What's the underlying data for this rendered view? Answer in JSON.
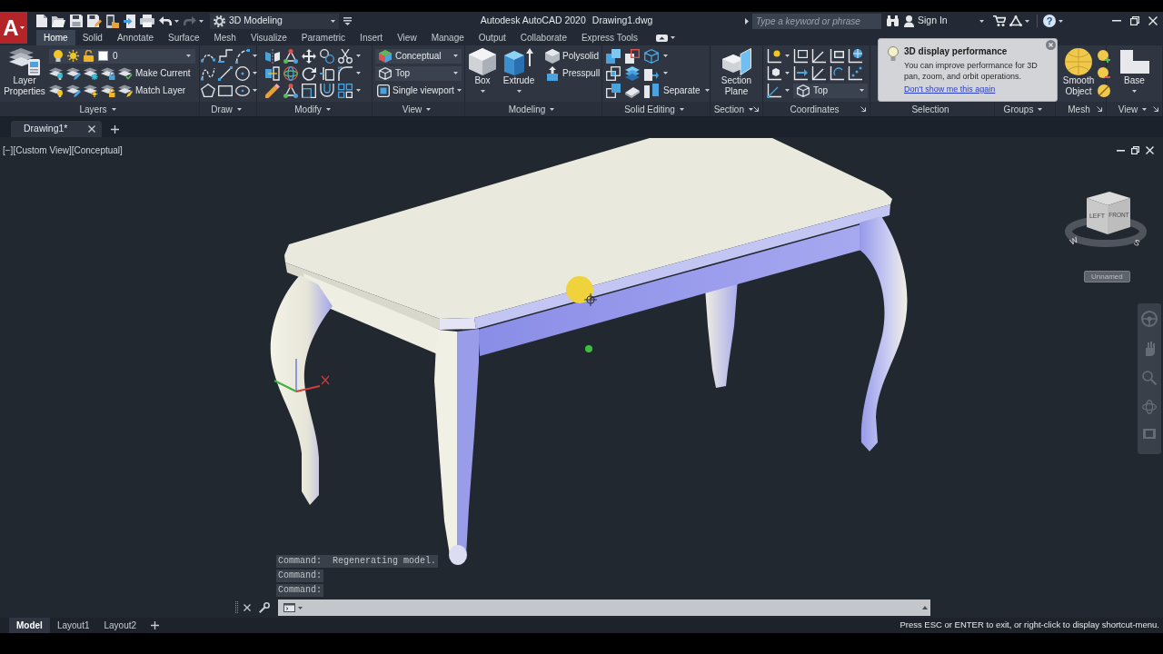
{
  "title_bar": {
    "app_button": "A",
    "workspace": "3D Modeling",
    "app_title": "Autodesk AutoCAD 2020",
    "document_title": "Drawing1.dwg",
    "search": {
      "placeholder": "Type a keyword or phrase"
    },
    "sign_in": "Sign In",
    "help": "?"
  },
  "ribbon_tabs": [
    {
      "label": "Home",
      "selected": true
    },
    {
      "label": "Solid",
      "selected": false
    },
    {
      "label": "Annotate",
      "selected": false
    },
    {
      "label": "Surface",
      "selected": false
    },
    {
      "label": "Mesh",
      "selected": false
    },
    {
      "label": "Visualize",
      "selected": false
    },
    {
      "label": "Parametric",
      "selected": false
    },
    {
      "label": "Insert",
      "selected": false
    },
    {
      "label": "View",
      "selected": false
    },
    {
      "label": "Manage",
      "selected": false
    },
    {
      "label": "Output",
      "selected": false
    },
    {
      "label": "Collaborate",
      "selected": false
    },
    {
      "label": "Express Tools",
      "selected": false
    }
  ],
  "ribbon_panels": [
    {
      "kind": "layers",
      "label": "Layers",
      "expandable": true,
      "large_button": "Layer Properties",
      "current_layer": "0",
      "buttons": [
        "Make Current",
        "Match Layer"
      ]
    },
    {
      "kind": "draw",
      "label": "Draw",
      "expandable": true
    },
    {
      "kind": "modify",
      "label": "Modify",
      "expandable": true
    },
    {
      "kind": "view",
      "label": "View",
      "expandable": true,
      "visual_style": "Conceptual",
      "view": "Top",
      "viewports": "Single viewport"
    },
    {
      "kind": "modeling",
      "label": "Modeling",
      "expandable": true,
      "large_buttons": [
        "Box",
        "Extrude"
      ],
      "buttons": [
        "Polysolid",
        "Presspull"
      ]
    },
    {
      "kind": "solid_editing",
      "label": "Solid Editing",
      "expandable": true,
      "buttons": [
        "Separate"
      ]
    },
    {
      "kind": "section",
      "label": "Section",
      "expandable": true,
      "launcher": true,
      "large_button": "Section Plane"
    },
    {
      "kind": "coordinates",
      "label": "Coordinates",
      "launcher": true,
      "view": "Top"
    },
    {
      "kind": "selection",
      "label": "Selection"
    },
    {
      "kind": "groups",
      "label": "Groups",
      "expandable": true
    },
    {
      "kind": "mesh",
      "label": "Mesh",
      "launcher": true,
      "large_button": "Smooth Object"
    },
    {
      "kind": "base",
      "label": "View",
      "expandable": true,
      "launcher": true,
      "large_button": "Base"
    }
  ],
  "tooltip": {
    "title": "3D display performance",
    "message": "You can improve performance for 3D pan, zoom, and orbit operations.",
    "link": "Don't show me this again"
  },
  "document_tabs": [
    {
      "label": "Drawing1*",
      "selected": true
    }
  ],
  "viewport": {
    "view_controls": [
      "[−]",
      "[Custom View]",
      "[Conceptual]"
    ],
    "viewcube": {
      "faces": [
        "LEFT",
        "FRONT"
      ],
      "compass": [
        "W",
        "S"
      ]
    },
    "ucs_menu": "Unnamed"
  },
  "command_history": [
    "Command:  Regenerating model.",
    "Command:",
    "Command:"
  ],
  "layout_tabs": [
    {
      "label": "Model",
      "selected": true
    },
    {
      "label": "Layout1",
      "selected": false
    },
    {
      "label": "Layout2",
      "selected": false
    }
  ],
  "status_message": "Press ESC or ENTER to exit, or right-click to display shortcut-menu."
}
